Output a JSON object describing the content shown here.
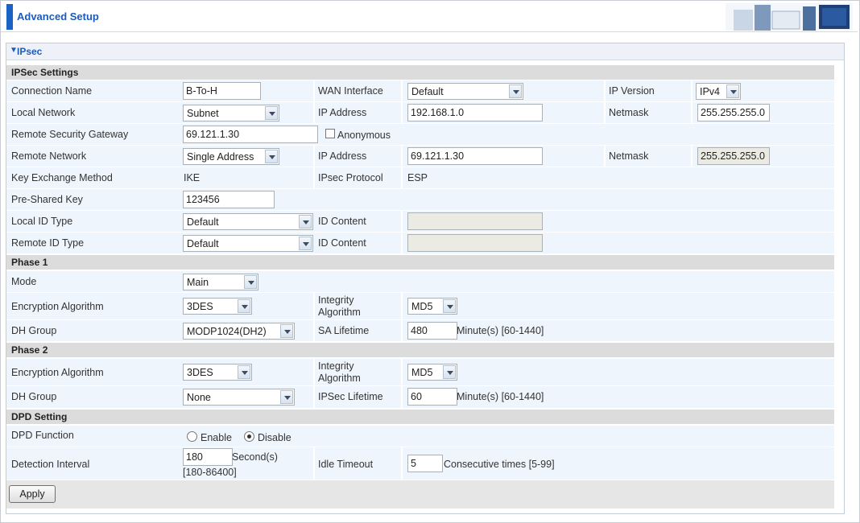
{
  "header": {
    "title": "Advanced Setup"
  },
  "panel": {
    "title": "IPsec"
  },
  "sections": {
    "ipsec": "IPSec Settings",
    "phase1": "Phase 1",
    "phase2": "Phase 2",
    "dpd": "DPD Setting"
  },
  "ipsec": {
    "connection_name_label": "Connection Name",
    "connection_name": "B-To-H",
    "wan_interface_label": "WAN Interface",
    "wan_interface": "Default",
    "ip_version_label": "IP Version",
    "ip_version": "IPv4",
    "local_network_label": "Local Network",
    "local_network": "Subnet",
    "local_ip_label": "IP Address",
    "local_ip": "192.168.1.0",
    "local_netmask_label": "Netmask",
    "local_netmask": "255.255.255.0",
    "remote_gateway_label": "Remote Security Gateway",
    "remote_gateway": "69.121.1.30",
    "anonymous_label": "Anonymous",
    "remote_network_label": "Remote Network",
    "remote_network": "Single Address",
    "remote_ip_label": "IP Address",
    "remote_ip": "69.121.1.30",
    "remote_netmask_label": "Netmask",
    "remote_netmask": "255.255.255.0",
    "key_exchange_label": "Key Exchange Method",
    "key_exchange": "IKE",
    "protocol_label": "IPsec Protocol",
    "protocol": "ESP",
    "psk_label": "Pre-Shared Key",
    "psk": "123456",
    "local_id_type_label": "Local ID Type",
    "local_id_type": "Default",
    "local_id_content_label": "ID Content",
    "remote_id_type_label": "Remote ID Type",
    "remote_id_type": "Default",
    "remote_id_content_label": "ID Content"
  },
  "phase1": {
    "mode_label": "Mode",
    "mode": "Main",
    "enc_label": "Encryption Algorithm",
    "enc": "3DES",
    "integrity_label_1": "Integrity",
    "integrity_label_2": "Algorithm",
    "integrity": "MD5",
    "dh_label": "DH Group",
    "dh": "MODP1024(DH2)",
    "sa_label": "SA Lifetime",
    "sa": "480",
    "sa_unit": "Minute(s) [60-1440]"
  },
  "phase2": {
    "enc_label": "Encryption Algorithm",
    "enc": "3DES",
    "integrity_label_1": "Integrity",
    "integrity_label_2": "Algorithm",
    "integrity": "MD5",
    "dh_label": "DH Group",
    "dh": "None",
    "lifetime_label": "IPSec Lifetime",
    "lifetime": "60",
    "lifetime_unit": "Minute(s) [60-1440]"
  },
  "dpd": {
    "function_label": "DPD Function",
    "enable_label": "Enable",
    "disable_label": "Disable",
    "selected": "Disable",
    "interval_label": "Detection Interval",
    "interval": "180",
    "interval_unit": "Second(s)",
    "interval_range": "[180-86400]",
    "idle_label": "Idle Timeout",
    "idle": "5",
    "idle_unit": "Consecutive times [5-99]"
  },
  "buttons": {
    "apply": "Apply"
  }
}
